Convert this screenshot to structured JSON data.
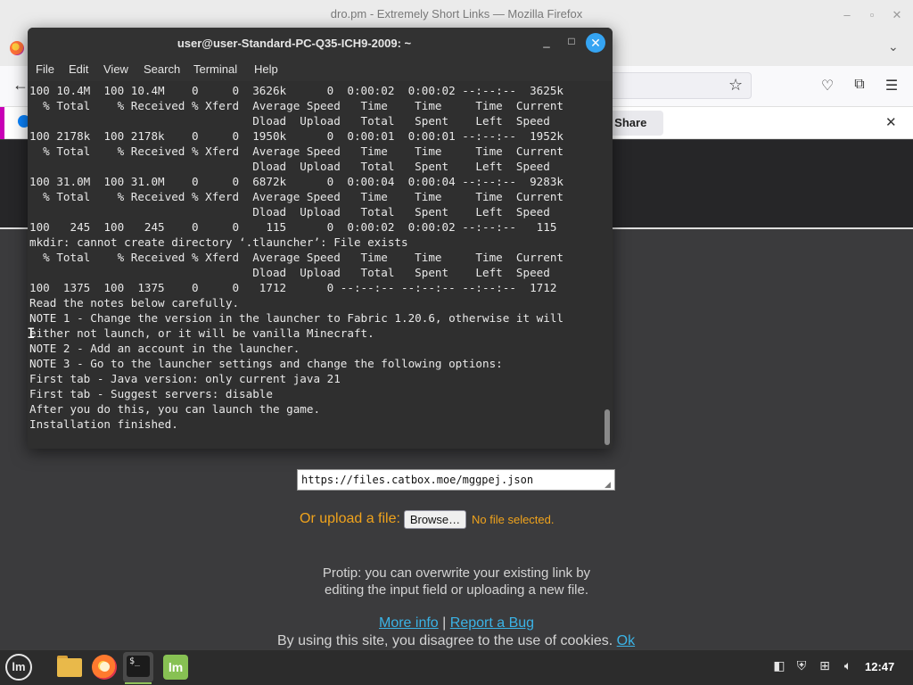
{
  "firefox": {
    "window_title": "dro.pm - Extremely Short Links — Mozilla Firefox",
    "notification": {
      "button_label": "t I Share"
    },
    "page": {
      "url_input_value": "https://files.catbox.moe/mggpej.json",
      "upload_label": "Or upload a file:",
      "browse_label": "Browse…",
      "no_file_label": "No file selected.",
      "protip_line1": "Protip: you can overwrite your existing link by",
      "protip_line2": "editing the input field or uploading a new file.",
      "more_info_label": "More info",
      "separator": "|",
      "report_bug_label": "Report a Bug",
      "cookie_text": "By using this site, you disagree to the use of cookies.",
      "cookie_ok_label": "Ok"
    }
  },
  "terminal": {
    "title": "user@user-Standard-PC-Q35-ICH9-2009: ~",
    "menu": [
      "File",
      "Edit",
      "View",
      "Search",
      "Terminal",
      "Help"
    ],
    "lines": [
      "100 10.4M  100 10.4M    0     0  3626k      0  0:00:02  0:00:02 --:--:--  3625k",
      "  % Total    % Received % Xferd  Average Speed   Time    Time     Time  Current",
      "                                 Dload  Upload   Total   Spent    Left  Speed",
      "100 2178k  100 2178k    0     0  1950k      0  0:00:01  0:00:01 --:--:--  1952k",
      "  % Total    % Received % Xferd  Average Speed   Time    Time     Time  Current",
      "                                 Dload  Upload   Total   Spent    Left  Speed",
      "100 31.0M  100 31.0M    0     0  6872k      0  0:00:04  0:00:04 --:--:--  9283k",
      "  % Total    % Received % Xferd  Average Speed   Time    Time     Time  Current",
      "                                 Dload  Upload   Total   Spent    Left  Speed",
      "100   245  100   245    0     0    115      0  0:00:02  0:00:02 --:--:--   115",
      "mkdir: cannot create directory ‘.tlauncher’: File exists",
      "  % Total    % Received % Xferd  Average Speed   Time    Time     Time  Current",
      "                                 Dload  Upload   Total   Spent    Left  Speed",
      "100  1375  100  1375    0     0   1712      0 --:--:-- --:--:-- --:--:--  1712",
      "Read the notes below carefully.",
      "NOTE 1 - Change the version in the launcher to Fabric 1.20.6, otherwise it will",
      "either not launch, or it will be vanilla Minecraft.",
      "NOTE 2 - Add an account in the launcher.",
      "NOTE 3 - Go to the launcher settings and change the following options:",
      "First tab - Java version: only current java 21",
      "First tab - Suggest servers: disable",
      "After you do this, you can launch the game.",
      "Installation finished."
    ]
  },
  "taskbar": {
    "menu_logo_glyph": "lm",
    "terminal_glyph": "$_",
    "mintupdate_glyph": "lm",
    "clock": "12:47"
  }
}
